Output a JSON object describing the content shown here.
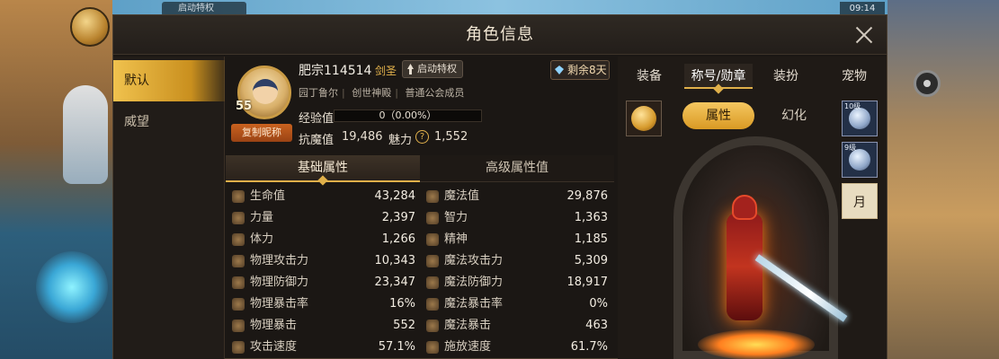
{
  "background": {
    "top_chip": "启动特权",
    "top_time": "09:14"
  },
  "dialog": {
    "title": "角色信息"
  },
  "side_nav": [
    {
      "label": "默认",
      "active": true
    },
    {
      "label": "威望",
      "active": false
    }
  ],
  "profile": {
    "level": "55",
    "copy_button": "复制昵称",
    "name": "肥宗114514",
    "class": "剑圣",
    "boost_button": "启动特权",
    "remaining": "剩余8天",
    "guild": [
      "园丁鲁尔",
      "创世神殿",
      "普通公会成员"
    ],
    "exp_label": "经验值",
    "exp_value": "0（0.00%）",
    "exp_fraction": 0.0,
    "resist_label": "抗魔值",
    "resist_value": "19,486",
    "charm_label": "魅力",
    "charm_value": "1,552"
  },
  "attr_tabs": [
    {
      "label": "基础属性",
      "active": true
    },
    {
      "label": "高级属性值",
      "active": false
    }
  ],
  "stats": [
    {
      "left": {
        "name": "生命值",
        "value": "43,284"
      },
      "right": {
        "name": "魔法值",
        "value": "29,876"
      }
    },
    {
      "left": {
        "name": "力量",
        "value": "2,397"
      },
      "right": {
        "name": "智力",
        "value": "1,363"
      }
    },
    {
      "left": {
        "name": "体力",
        "value": "1,266"
      },
      "right": {
        "name": "精神",
        "value": "1,185"
      }
    },
    {
      "left": {
        "name": "物理攻击力",
        "value": "10,343"
      },
      "right": {
        "name": "魔法攻击力",
        "value": "5,309"
      }
    },
    {
      "left": {
        "name": "物理防御力",
        "value": "23,347"
      },
      "right": {
        "name": "魔法防御力",
        "value": "18,917"
      }
    },
    {
      "left": {
        "name": "物理暴击率",
        "value": "16%"
      },
      "right": {
        "name": "魔法暴击率",
        "value": "0%"
      }
    },
    {
      "left": {
        "name": "物理暴击",
        "value": "552"
      },
      "right": {
        "name": "魔法暴击",
        "value": "463"
      }
    },
    {
      "left": {
        "name": "攻击速度",
        "value": "57.1%"
      },
      "right": {
        "name": "施放速度",
        "value": "61.7%"
      }
    }
  ],
  "right_tabs": [
    {
      "label": "装备",
      "active": false
    },
    {
      "label": "称号/勋章",
      "active": true
    },
    {
      "label": "装扮",
      "active": false
    },
    {
      "label": "宠物",
      "active": false
    }
  ],
  "segment": {
    "attr": "属性",
    "illusion": "幻化"
  },
  "side_slots": [
    {
      "text": "10级",
      "icon": "gem-icon"
    },
    {
      "text": "9级",
      "icon": "gem-icon"
    },
    {
      "text": "月",
      "icon": "scroll-icon"
    }
  ],
  "colors": {
    "accent_gold": "#e0b04a",
    "orange_button": "#c9621f",
    "panel_dark": "#1b1714"
  }
}
